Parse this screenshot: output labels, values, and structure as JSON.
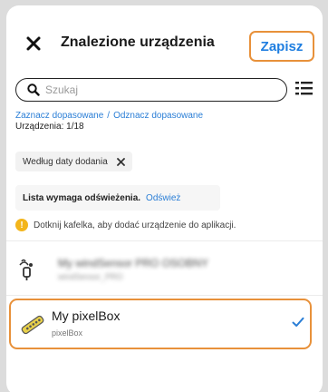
{
  "header": {
    "title": "Znalezione urządzenia",
    "save_label": "Zapisz",
    "close_icon": "close-icon"
  },
  "search": {
    "placeholder": "Szukaj",
    "value": ""
  },
  "selection": {
    "select_matching": "Zaznacz dopasowane",
    "separator": "/",
    "deselect_matching": "Odznacz dopasowane",
    "count_label": "Urządzenia: 1/18"
  },
  "sort": {
    "chip_label": "Według daty dodania"
  },
  "refresh": {
    "message": "Lista wymaga odświeżenia.",
    "link": "Odśwież"
  },
  "hint": {
    "icon_text": "!",
    "text": "Dotknij kafelka, aby dodać urządzenie do aplikacji."
  },
  "devices": [
    {
      "name": "My windSensor PRO OSOBNY",
      "type": "windSensor_PRO",
      "selected": false,
      "blurred": true,
      "icon": "wind-sensor-icon"
    },
    {
      "name": "My pixelBox",
      "type": "pixelBox",
      "selected": true,
      "blurred": false,
      "icon": "pixelbox-icon"
    }
  ],
  "colors": {
    "accent_orange": "#e8913a",
    "link_blue": "#2a7ed6",
    "save_blue": "#1f7ee0",
    "hint_yellow": "#f3b51b",
    "pixelbox_yellow": "#e8d04a"
  }
}
